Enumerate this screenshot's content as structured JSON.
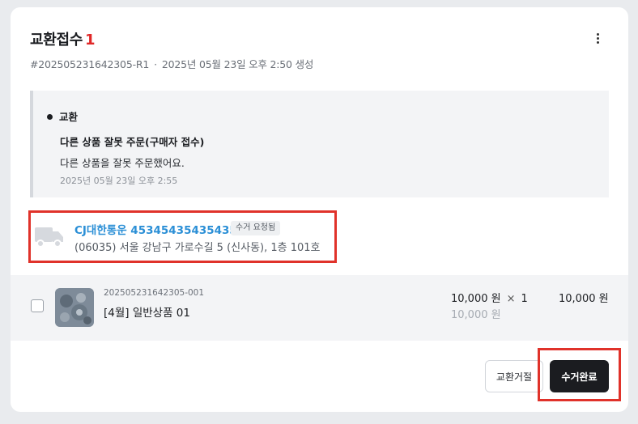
{
  "header": {
    "title": "교환접수",
    "count": "1",
    "order_id": "#202505231642305-R1",
    "separator": "·",
    "created_at": "2025년 05월 23일 오후 2:50 생성"
  },
  "reason": {
    "type": "교환",
    "title": "다른 상품 잘못 주문(구매자 접수)",
    "description": "다른 상품을 잘못 주문했어요.",
    "date": "2025년 05월 23일 오후 2:55"
  },
  "shipping": {
    "carrier_tracking": "CJ대한통운 45345435435435",
    "status_badge": "수거 요청됨",
    "address": "(06035) 서울 강남구 가로수길 5 (신사동), 1층 101호",
    "icon": "truck-icon"
  },
  "item": {
    "code": "202505231642305-001",
    "name": "[4월] 일반상품 01",
    "price": "10,000 원",
    "times": "×",
    "quantity": "1",
    "original_price": "10,000 원",
    "total": "10,000 원",
    "checked": false
  },
  "actions": {
    "reject_label": "교환거절",
    "complete_label": "수거완료"
  },
  "colors": {
    "accent_red": "#e02727",
    "link_blue": "#2b8fd6",
    "highlight_red": "#e0322a",
    "primary_button": "#1b1c20"
  }
}
